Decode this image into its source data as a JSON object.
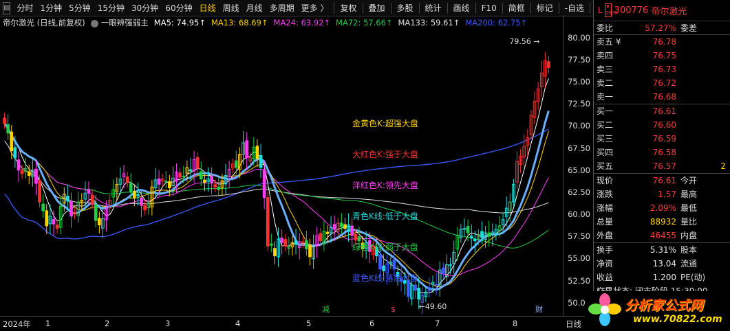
{
  "toolbar": {
    "periods": [
      "分时",
      "1分钟",
      "5分钟",
      "15分钟",
      "30分钟",
      "60分钟",
      "日线",
      "周线",
      "月线",
      "多周期",
      "更多 〉"
    ],
    "active_period": "日线",
    "tools": [
      "复权",
      "叠加",
      "多股",
      "统计",
      "画线",
      "F10",
      "简框",
      "标记",
      "-自选",
      "返回"
    ]
  },
  "legend": {
    "title": "帝尔激光 (日线,前复权)",
    "indicator": "一眼辨强弱主",
    "ma": [
      {
        "label": "MA5: 74.95",
        "color": "#ffffff"
      },
      {
        "label": "MA13: 68.69",
        "color": "#ffd200"
      },
      {
        "label": "MA24: 63.92",
        "color": "#ff3df5"
      },
      {
        "label": "MA72: 57.66",
        "color": "#22cc44"
      },
      {
        "label": "MA133: 59.61",
        "color": "#e0e0e0"
      },
      {
        "label": "MA200: 62.75",
        "color": "#3b5bff"
      }
    ],
    "arrow": "↑"
  },
  "chart_data": {
    "type": "candlestick",
    "ylim": [
      48.5,
      81.0
    ],
    "yticks": [
      "80.00",
      "77.50",
      "75.00",
      "72.50",
      "70.00",
      "67.50",
      "65.00",
      "62.50",
      "60.00",
      "57.50",
      "55.00",
      "52.50",
      "50.00"
    ],
    "xticks": [
      "2024年",
      "1",
      "2",
      "3",
      "4",
      "5",
      "6",
      "7",
      "8"
    ],
    "x_unit": "日线",
    "annotations": {
      "high": "79.56",
      "low": "←49.60"
    },
    "markers": [
      {
        "text": "减",
        "color": "#22cc44"
      },
      {
        "text": "$",
        "color": "#ff3b3b"
      },
      {
        "text": "财",
        "color": "#9ab4ff"
      }
    ],
    "text_notes": [
      {
        "text": "金黄色K:超强大盘",
        "color": "#ffd200"
      },
      {
        "text": "大红色K:强于大盘",
        "color": "#ff3030"
      },
      {
        "text": "洋红色K:领先大盘",
        "color": "#ff3df5"
      },
      {
        "text": "青色K线:低于大盘",
        "color": "#22dddd"
      },
      {
        "text": "绿色K线:弱于大盘",
        "color": "#22cc44"
      },
      {
        "text": "蓝色K线:落后大盘",
        "color": "#3b5bff"
      }
    ],
    "closes": [
      70.3,
      69.2,
      67.2,
      66.4,
      65.0,
      64.6,
      65.2,
      64.4,
      65.0,
      63.5,
      61.4,
      60.4,
      58.7,
      59.8,
      58.9,
      58.4,
      60.9,
      62.3,
      61.5,
      59.8,
      60.2,
      61.4,
      61.6,
      62.4,
      62.4,
      61.1,
      59.3,
      58.8,
      59.5,
      60.6,
      61.6,
      62.8,
      63.4,
      64.0,
      64.6,
      63.6,
      62.5,
      61.9,
      62.1,
      61.0,
      60.5,
      61.2,
      63.1,
      63.9,
      63.4,
      64.0,
      63.7,
      63.0,
      64.1,
      64.8,
      64.2,
      64.3,
      65.3,
      64.9,
      66.2,
      65.2,
      64.0,
      63.6,
      64.0,
      63.6,
      63.1,
      62.8,
      63.8,
      64.4,
      65.1,
      65.7,
      65.3,
      66.8,
      68.1,
      66.4,
      66.4,
      67.6,
      66.3,
      65.3,
      61.9,
      56.4,
      56.5,
      55.3,
      57.2,
      56.8,
      56.4,
      56.3,
      56.8,
      56.6,
      56.9,
      56.9,
      56.1,
      55.2,
      56.4,
      57.6,
      57.0,
      58.1,
      57.8,
      58.5,
      58.3,
      59.0,
      58.6,
      58.4,
      58.8,
      57.6,
      57.1,
      57.0,
      56.1,
      56.8,
      55.8,
      56.4,
      55.3,
      53.8,
      53.6,
      54.4,
      54.6,
      53.8,
      52.9,
      52.4,
      52.2,
      50.7,
      52.0,
      51.4,
      50.4,
      50.8,
      51.2,
      51.7,
      52.3,
      52.0,
      53.7,
      53.3,
      54.3,
      54.3,
      55.7,
      57.6,
      58.3,
      58.4,
      57.9,
      57.3,
      57.0,
      57.7,
      57.4,
      57.9,
      57.5,
      58.0,
      58.3,
      58.7,
      59.4,
      60.7,
      61.4,
      63.4,
      66.0,
      66.6,
      67.7,
      68.7,
      71.2,
      72.8,
      74.2,
      76.0,
      77.4,
      76.6
    ]
  },
  "panel": {
    "header": {
      "l": "L",
      "rbox": "R 1000",
      "code": "300776",
      "name": "帝尔激光"
    },
    "webi": {
      "label": "委比",
      "value": "57.27%",
      "label2": "委差"
    },
    "asks": [
      {
        "label": "卖五 ¥",
        "price": "76.78",
        "vol": ""
      },
      {
        "label": "卖四",
        "price": "76.75",
        "vol": ""
      },
      {
        "label": "卖三",
        "price": "76.73",
        "vol": ""
      },
      {
        "label": "卖二",
        "price": "76.72",
        "vol": ""
      },
      {
        "label": "卖一",
        "price": "76.68",
        "vol": ""
      }
    ],
    "bids": [
      {
        "label": "买一",
        "price": "76.61",
        "vol": ""
      },
      {
        "label": "买二",
        "price": "76.60",
        "vol": ""
      },
      {
        "label": "买三",
        "price": "76.59",
        "vol": ""
      },
      {
        "label": "买四",
        "price": "76.58",
        "vol": ""
      },
      {
        "label": "买五",
        "price": "76.57",
        "vol": "2"
      }
    ],
    "quote": [
      {
        "k": "现价",
        "v": "76.61",
        "c": "red",
        "k2": "今开"
      },
      {
        "k": "涨跌",
        "v": "1.57",
        "c": "red",
        "k2": "最高"
      },
      {
        "k": "涨幅",
        "v": "2.09%",
        "c": "red",
        "k2": "最低"
      },
      {
        "k": "总量",
        "v": "88932",
        "c": "yellow",
        "k2": "量比"
      },
      {
        "k": "外盘",
        "v": "46455",
        "c": "red",
        "k2": "内盘"
      }
    ],
    "stats": [
      {
        "k": "换手",
        "v": "5.31%",
        "c": "white",
        "k2": "股本"
      },
      {
        "k": "净资",
        "v": "13.04",
        "c": "white",
        "k2": "流通"
      },
      {
        "k": "收益(三)",
        "v": "1.200",
        "c": "white",
        "k2": "PE(动)"
      }
    ],
    "status": "交易状态: 闭市阶段 15:30:00"
  },
  "ad": {
    "line1": "分析家公式网",
    "line2": "www.70822.com"
  }
}
